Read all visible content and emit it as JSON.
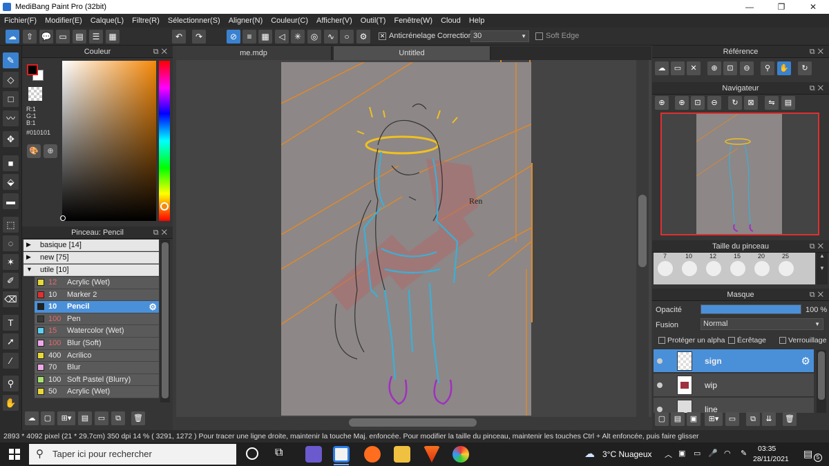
{
  "app": {
    "title": "MediBang Paint Pro (32bit)",
    "window_buttons": [
      "—",
      "❐",
      "✕"
    ]
  },
  "menu": [
    "Fichier(F)",
    "Modifier(E)",
    "Calque(L)",
    "Filtre(R)",
    "Sélectionner(S)",
    "Aligner(N)",
    "Couleur(C)",
    "Afficher(V)",
    "Outil(T)",
    "Fenêtre(W)",
    "Cloud",
    "Help"
  ],
  "toolbar": {
    "antialias_label": "Anticrénelage",
    "correction_label": "Correction",
    "correction_value": "30",
    "soft_edge_label": "Soft Edge"
  },
  "color_panel": {
    "title": "Couleur",
    "r": "R:1",
    "g": "G:1",
    "b": "B:1",
    "hex": "#010101",
    "primary_color": "#010101",
    "hue_marker_color": "#f58a0a"
  },
  "brush_panel": {
    "title": "Pinceau: Pencil",
    "groups": [
      {
        "label": "basique [14]",
        "tri": "▶"
      },
      {
        "label": "new [75]",
        "tri": "▶"
      },
      {
        "label": "utile [10]",
        "tri": "▼"
      }
    ],
    "brushes": [
      {
        "size": "12",
        "name": "Acrylic (Wet)",
        "color": "#e8d838",
        "size_color": "#e26a6a"
      },
      {
        "size": "10",
        "name": "Marker 2",
        "color": "#e03030",
        "size_color": "#e8e8e8"
      },
      {
        "size": "10",
        "name": "Pencil",
        "color": "#222222",
        "size_color": "#ffffff"
      },
      {
        "size": "100",
        "name": "Pen",
        "color": "#3a3a3a",
        "size_color": "#e26a6a"
      },
      {
        "size": "15",
        "name": "Watercolor (Wet)",
        "color": "#5fd0f0",
        "size_color": "#e26a6a"
      },
      {
        "size": "100",
        "name": "Blur (Soft)",
        "color": "#f0a8e8",
        "size_color": "#e26a6a"
      },
      {
        "size": "400",
        "name": "Acrilico",
        "color": "#e8d838",
        "size_color": "#e8e8e8"
      },
      {
        "size": "70",
        "name": "Blur",
        "color": "#f0a8e8",
        "size_color": "#e8e8e8"
      },
      {
        "size": "100",
        "name": "Soft Pastel (Blurry)",
        "color": "#a8e070",
        "size_color": "#e8e8e8"
      },
      {
        "size": "50",
        "name": "Acrylic (Wet)",
        "color": "#e8d838",
        "size_color": "#e8e8e8"
      }
    ]
  },
  "tabs": [
    {
      "label": "me.mdp"
    },
    {
      "label": "Untitled"
    }
  ],
  "canvas": {
    "drawing_text": "Ren"
  },
  "right": {
    "reference_title": "Référence",
    "navigator_title": "Navigateur",
    "brush_size_title": "Taille du pinceau",
    "brush_sizes_top": [
      "7",
      "10",
      "12",
      "15",
      "20",
      "25"
    ],
    "mask_title": "Masque",
    "opacity_label": "Opacité",
    "opacity_value": "100 %",
    "opacity_fraction": 1.0,
    "fusion_label": "Fusion",
    "fusion_value": "Normal",
    "alpha_protect": "Protéger un alpha",
    "clipping": "Écrêtage",
    "lock": "Verrouillage",
    "layers": [
      {
        "name": "sign",
        "selected": true
      },
      {
        "name": "wip",
        "selected": false
      },
      {
        "name": "line",
        "selected": false
      }
    ]
  },
  "status": {
    "text": "2893 * 4092 pixel   (21 * 29.7cm)   350 dpi   14 %   ( 3291, 1272 )   Pour tracer une ligne droite, maintenir la touche Maj. enfoncée. Pour modifier la taille du pinceau, maintenir les touches Ctrl + Alt enfoncée, puis faire glisser"
  },
  "taskbar": {
    "search_placeholder": "Taper ici pour rechercher",
    "weather": "3°C  Nuageux",
    "time": "03:35",
    "date": "28/11/2021",
    "notif_count": "5"
  }
}
